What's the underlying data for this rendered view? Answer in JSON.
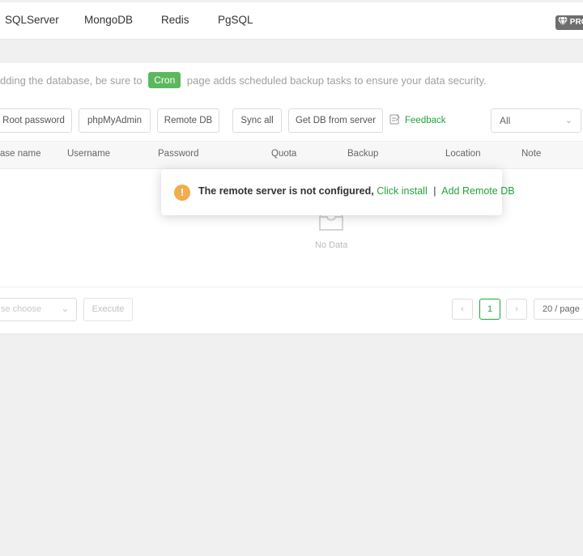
{
  "nav": {
    "tabs": [
      "SQLServer",
      "MongoDB",
      "Redis",
      "PgSQL"
    ],
    "pro_label": "PRO"
  },
  "tip": {
    "before": "dding the database, be sure to",
    "cron": "Cron",
    "after": "page adds scheduled backup tasks to ensure your data security."
  },
  "toolbar": {
    "root_password": "Root password",
    "phpmyadmin": "phpMyAdmin",
    "remote_db": "Remote DB",
    "sync_all": "Sync all",
    "get_db": "Get DB from server",
    "feedback": "Feedback",
    "filter_value": "All"
  },
  "table": {
    "columns": [
      "ase name",
      "Username",
      "Password",
      "Quota",
      "Backup",
      "Location",
      "Note"
    ],
    "empty_text": "No Data"
  },
  "footer": {
    "batch_placeholder": "se choose",
    "execute": "Execute",
    "current_page": "1",
    "page_size": "20 / page"
  },
  "popup": {
    "message": "The remote server is not configured,",
    "install_link": "Click install",
    "separator": "|",
    "add_link": "Add Remote DB"
  },
  "colors": {
    "accent": "#20a53a",
    "cron_badge": "#5cb85c",
    "warning": "#f0ad4e"
  },
  "icons": [
    "diamond-icon",
    "feedback-icon",
    "chevron-down-icon",
    "empty-box-icon",
    "warning-icon",
    "chevron-left-icon",
    "chevron-right-icon"
  ]
}
